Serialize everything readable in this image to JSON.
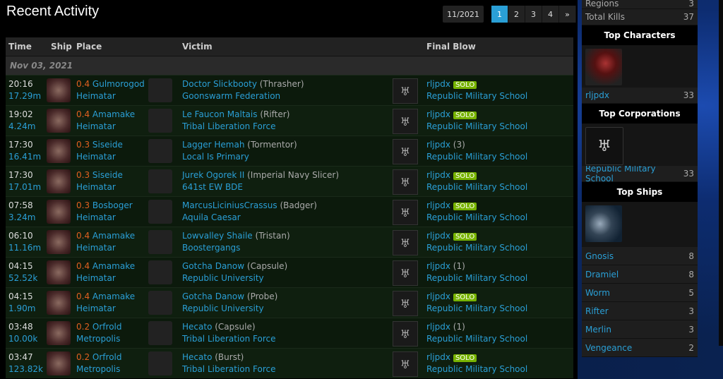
{
  "header": {
    "title": "Recent Activity",
    "month": "11/2021",
    "pages": [
      "1",
      "2",
      "3",
      "4",
      "»"
    ]
  },
  "table": {
    "columns": {
      "time": "Time",
      "ship": "Ship",
      "place": "Place",
      "victim": "Victim",
      "final": "Final Blow"
    },
    "date": "Nov 03, 2021",
    "rows": [
      {
        "time": "20:16",
        "value": "17.29m",
        "sec": "0.4",
        "system": "Gulmorogod",
        "region": "Heimatar",
        "victim": "Doctor Slickbooty",
        "ship": "(Thrasher)",
        "corp": "Goonswarm Federation",
        "fb": "rljpdx",
        "solo": "SOLO",
        "count": "",
        "fbcorp": "Republic Military School"
      },
      {
        "time": "19:02",
        "value": "4.24m",
        "sec": "0.4",
        "system": "Amamake",
        "region": "Heimatar",
        "victim": "Le Faucon Maltais",
        "ship": "(Rifter)",
        "corp": "Tribal Liberation Force",
        "fb": "rljpdx",
        "solo": "SOLO",
        "count": "",
        "fbcorp": "Republic Military School"
      },
      {
        "time": "17:30",
        "value": "16.41m",
        "sec": "0.3",
        "system": "Siseide",
        "region": "Heimatar",
        "victim": "Lagger Hemah",
        "ship": "(Tormentor)",
        "corp": "Local Is Primary",
        "fb": "rljpdx",
        "solo": "",
        "count": "(3)",
        "fbcorp": "Republic Military School"
      },
      {
        "time": "17:30",
        "value": "17.01m",
        "sec": "0.3",
        "system": "Siseide",
        "region": "Heimatar",
        "victim": "Jurek Ogorek II",
        "ship": "(Imperial Navy Slicer)",
        "corp": "641st EW BDE",
        "fb": "rljpdx",
        "solo": "SOLO",
        "count": "",
        "fbcorp": "Republic Military School"
      },
      {
        "time": "07:58",
        "value": "3.24m",
        "sec": "0.3",
        "system": "Bosboger",
        "region": "Heimatar",
        "victim": "MarcusLiciniusCrassus",
        "ship": "(Badger)",
        "corp": "Aquila Caesar",
        "fb": "rljpdx",
        "solo": "SOLO",
        "count": "",
        "fbcorp": "Republic Military School"
      },
      {
        "time": "06:10",
        "value": "11.16m",
        "sec": "0.4",
        "system": "Amamake",
        "region": "Heimatar",
        "victim": "Lowvalley Shaile",
        "ship": "(Tristan)",
        "corp": "Boostergangs",
        "fb": "rljpdx",
        "solo": "SOLO",
        "count": "",
        "fbcorp": "Republic Military School"
      },
      {
        "time": "04:15",
        "value": "52.52k",
        "sec": "0.4",
        "system": "Amamake",
        "region": "Heimatar",
        "victim": "Gotcha Danow",
        "ship": "(Capsule)",
        "corp": "Republic University",
        "fb": "rljpdx",
        "solo": "",
        "count": "(1)",
        "fbcorp": "Republic Military School"
      },
      {
        "time": "04:15",
        "value": "1.90m",
        "sec": "0.4",
        "system": "Amamake",
        "region": "Heimatar",
        "victim": "Gotcha Danow",
        "ship": "(Probe)",
        "corp": "Republic University",
        "fb": "rljpdx",
        "solo": "SOLO",
        "count": "",
        "fbcorp": "Republic Military School"
      },
      {
        "time": "03:48",
        "value": "10.00k",
        "sec": "0.2",
        "system": "Orfrold",
        "region": "Metropolis",
        "victim": "Hecato",
        "ship": "(Capsule)",
        "corp": "Tribal Liberation Force",
        "fb": "rljpdx",
        "solo": "",
        "count": "(1)",
        "fbcorp": "Republic Military School"
      },
      {
        "time": "03:47",
        "value": "123.82k",
        "sec": "0.2",
        "system": "Orfrold",
        "region": "Metropolis",
        "victim": "Hecato",
        "ship": "(Burst)",
        "corp": "Tribal Liberation Force",
        "fb": "rljpdx",
        "solo": "SOLO",
        "count": "",
        "fbcorp": "Republic Military School"
      }
    ]
  },
  "side": {
    "regions_label": "Regions",
    "regions_value": "3",
    "kills_label": "Total Kills",
    "kills_value": "37",
    "top_chars": "Top Characters",
    "char_name": "rljpdx",
    "char_count": "33",
    "top_corps": "Top Corporations",
    "corp_name": "Republic Military School",
    "corp_count": "33",
    "top_ships": "Top Ships",
    "ships": [
      {
        "n": "Gnosis",
        "v": "8"
      },
      {
        "n": "Dramiel",
        "v": "8"
      },
      {
        "n": "Worm",
        "v": "5"
      },
      {
        "n": "Rifter",
        "v": "3"
      },
      {
        "n": "Merlin",
        "v": "3"
      },
      {
        "n": "Vengeance",
        "v": "2"
      }
    ]
  },
  "colors": {
    "accent": "#2a9fd6",
    "solo": "#77b300",
    "sec": "#e06020"
  }
}
